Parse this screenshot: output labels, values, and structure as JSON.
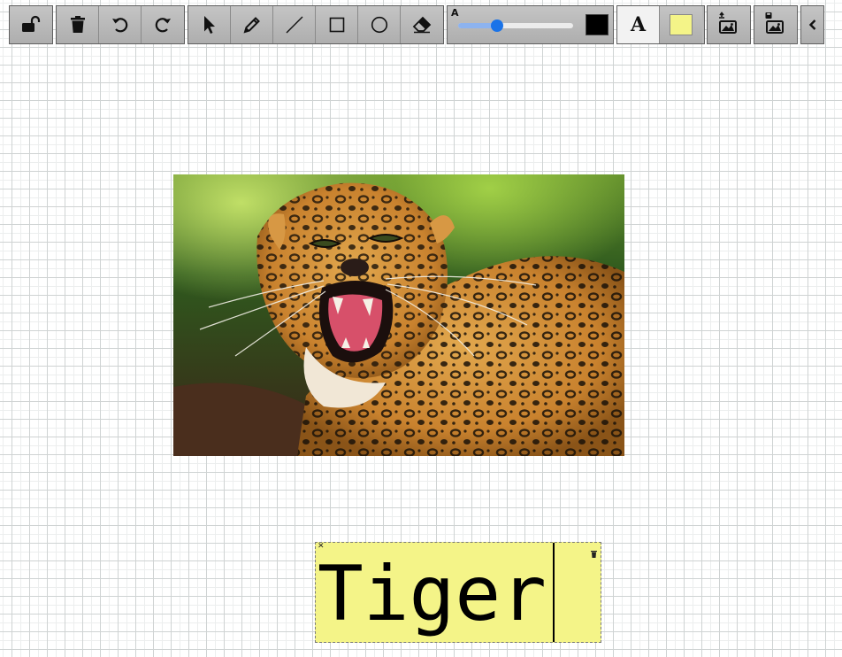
{
  "toolbar": {
    "lock_icon": "unlock-icon",
    "history": [
      "trash-icon",
      "undo-icon",
      "redo-icon"
    ],
    "tools": [
      "select-arrow-icon",
      "pencil-icon",
      "line-icon",
      "rectangle-icon",
      "circle-icon",
      "eraser-icon"
    ],
    "size_label": "A",
    "size_value": 0.34,
    "stroke_color": "#000000",
    "text_tool_label": "A",
    "fill_color": "#f4f488",
    "image_actions": [
      "upload-image-icon",
      "save-image-icon"
    ],
    "collapse_icon": "chevron-left-icon"
  },
  "canvas": {
    "grid_color": "#cfd3d3",
    "image": {
      "subject": "leopard-photo"
    },
    "text_box": {
      "text": "Tiger",
      "background": "#f4f488"
    }
  }
}
